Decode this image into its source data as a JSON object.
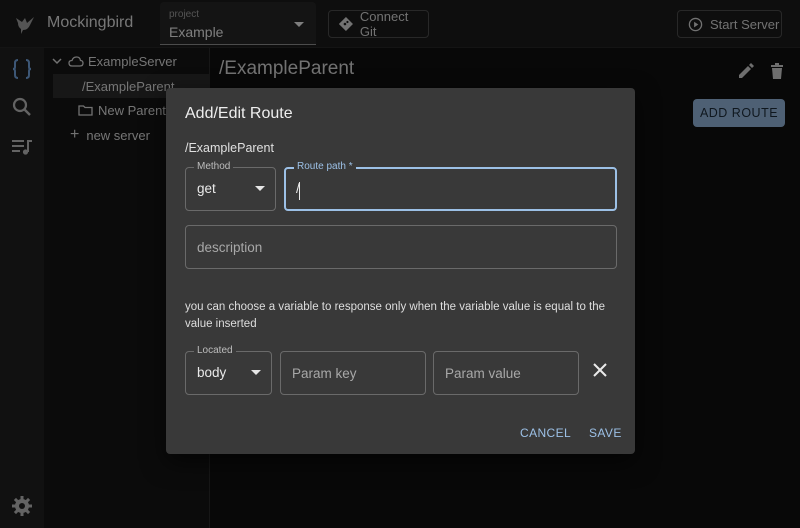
{
  "app": {
    "title": "Mockingbird"
  },
  "header": {
    "project_label": "project",
    "project_value": "Example",
    "connect_git_label": "Connect Git",
    "start_server_label": "Start Server"
  },
  "rail": {
    "icons": [
      "curly-braces-icon",
      "search-icon",
      "playlist-icon",
      "gear-icon"
    ]
  },
  "tree": {
    "server_name": "ExampleServer",
    "route_item": "/ExampleParent",
    "folder_item": "New Parent",
    "new_server_label": "new server"
  },
  "main": {
    "title": "/ExampleParent",
    "add_route_label": "ADD ROUTE"
  },
  "dialog": {
    "title": "Add/Edit Route",
    "path": "/ExampleParent",
    "method_label": "Method",
    "method_value": "get",
    "route_path_label": "Route path *",
    "route_path_value": "/",
    "description_placeholder": "description",
    "hint": "you can choose a variable to response only when the variable value is equal to the value inserted",
    "located_label": "Located",
    "located_value": "body",
    "param_key_placeholder": "Param key",
    "param_value_placeholder": "Param value",
    "cancel_label": "CANCEL",
    "save_label": "SAVE"
  },
  "colors": {
    "accent": "#9cc0e6",
    "add_route_bg": "#8fb0d4",
    "dialog_bg": "#393939",
    "rail_accent": "#6f9fd8"
  }
}
